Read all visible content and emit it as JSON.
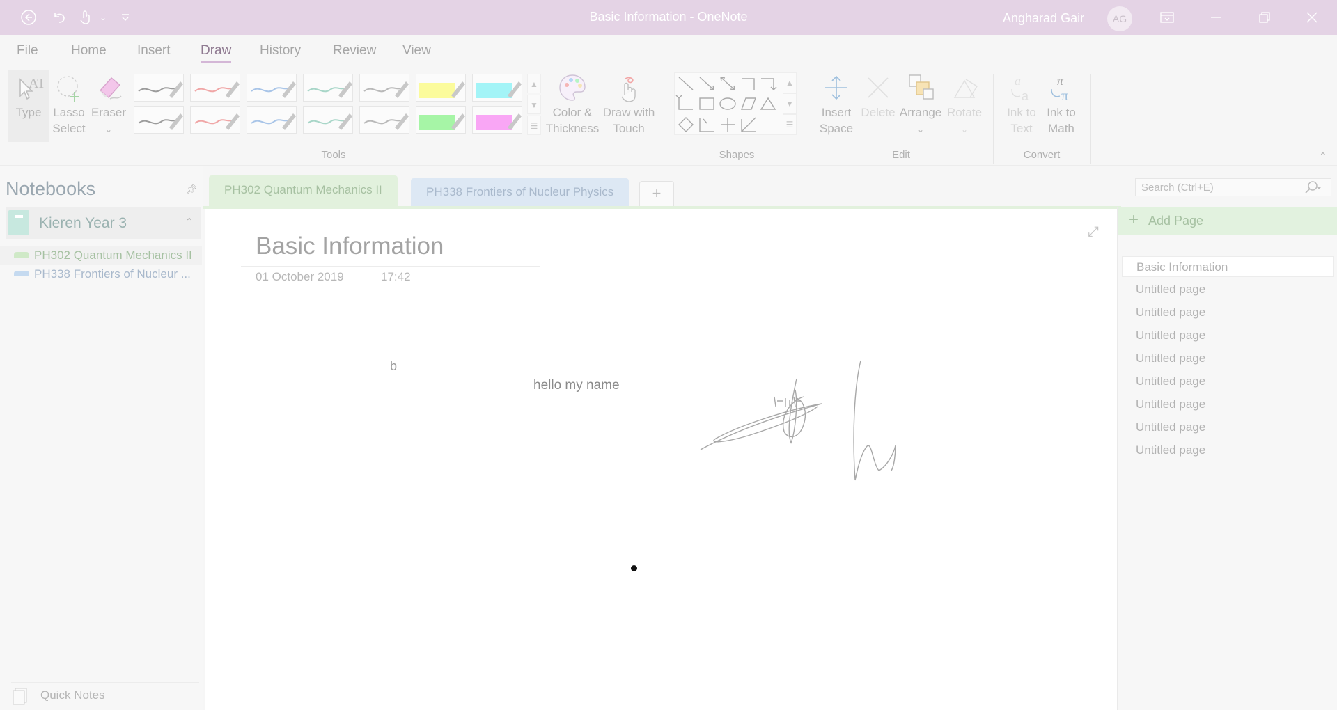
{
  "window": {
    "title": "Basic Information  -  OneNote",
    "user_name": "Angharad Gair",
    "user_initials": "AG"
  },
  "ribbon_tabs": [
    "File",
    "Home",
    "Insert",
    "Draw",
    "History",
    "Review",
    "View"
  ],
  "ribbon_active_tab": "Draw",
  "ribbon": {
    "tools": {
      "type": "Type",
      "lasso_line1": "Lasso",
      "lasso_line2": "Select",
      "eraser": "Eraser",
      "color_line1": "Color &",
      "color_line2": "Thickness",
      "touch_line1": "Draw with",
      "touch_line2": "Touch",
      "group": "Tools"
    },
    "shapes_group": "Shapes",
    "edit": {
      "insert_line1": "Insert",
      "insert_line2": "Space",
      "delete": "Delete",
      "arrange": "Arrange",
      "rotate": "Rotate",
      "group": "Edit"
    },
    "convert": {
      "ink_text_line1": "Ink to",
      "ink_text_line2": "Text",
      "ink_math_line1": "Ink to",
      "ink_math_line2": "Math",
      "group": "Convert"
    },
    "pen_colors": [
      "#9c9c9c",
      "#f0a6a6",
      "#a9c5e8",
      "#a8d6c8",
      "#b9b9b9",
      "#fbfb9c",
      "#a3f4f7",
      "#9c9c9c",
      "#f0a6a6",
      "#a9c5e8",
      "#a8d6c8",
      "#b9b9b9",
      "#a6f5a6",
      "#f9a6f5"
    ]
  },
  "notebooks": {
    "header": "Notebooks",
    "notebook_name": "Kieren Year 3",
    "sections": [
      {
        "label": "PH302 Quantum Mechanics II",
        "color": "#cfe9c7"
      },
      {
        "label": "PH338 Frontiers of Nucleur ...",
        "color": "#c5daf0"
      }
    ],
    "quick_notes": "Quick Notes"
  },
  "section_tabs": [
    {
      "label": "PH302 Quantum Mechanics II",
      "color": "#e2f1dd",
      "text_color": "#a7c1a2"
    },
    {
      "label": "PH338 Frontiers of Nucleur Physics",
      "color": "#dde8f4",
      "text_color": "#a9b9cc"
    }
  ],
  "page": {
    "title": "Basic Information",
    "date": "01 October 2019",
    "time": "17:42",
    "note_b": "b",
    "note_hello": "hello my name"
  },
  "search": {
    "placeholder": "Search (Ctrl+E)"
  },
  "pages_pane": {
    "add_page": "Add Page",
    "pages": [
      "Basic Information",
      "Untitled page",
      "Untitled page",
      "Untitled page",
      "Untitled page",
      "Untitled page",
      "Untitled page",
      "Untitled page",
      "Untitled page"
    ]
  }
}
